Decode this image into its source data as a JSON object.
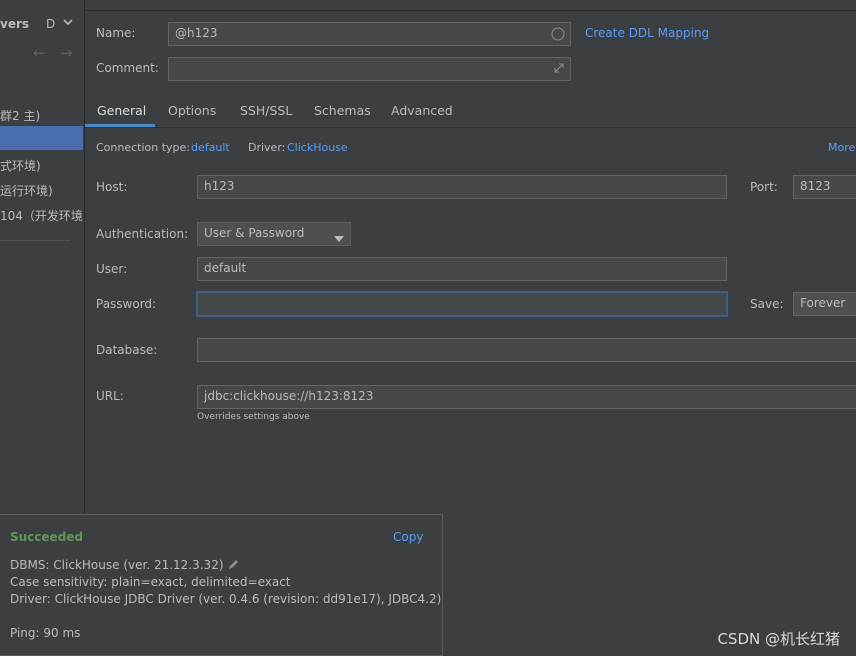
{
  "sidebar": {
    "title_fragment": "vers",
    "letter": "D",
    "items": [
      {
        "label": "群2 主)"
      },
      {
        "label": "式环境)"
      },
      {
        "label": "运行环境)"
      },
      {
        "label": "104（开发环境"
      }
    ]
  },
  "form": {
    "name_label": "Name:",
    "name_value": "@h123",
    "create_ddl_link": "Create DDL Mapping",
    "comment_label": "Comment:",
    "comment_value": ""
  },
  "tabs": [
    {
      "label": "General",
      "active": true
    },
    {
      "label": "Options"
    },
    {
      "label": "SSH/SSL"
    },
    {
      "label": "Schemas"
    },
    {
      "label": "Advanced"
    }
  ],
  "general": {
    "connection_type_label": "Connection type:",
    "connection_type_value": "default",
    "driver_label": "Driver:",
    "driver_value": "ClickHouse",
    "more_link": "More",
    "host_label": "Host:",
    "host_value": "h123",
    "port_label": "Port:",
    "port_value": "8123",
    "auth_label": "Authentication:",
    "auth_value": "User & Password",
    "user_label": "User:",
    "user_value": "default",
    "password_label": "Password:",
    "password_value": "",
    "save_label": "Save:",
    "save_value": "Forever",
    "database_label": "Database:",
    "database_value": "",
    "url_label": "URL:",
    "url_value": "jdbc:clickhouse://h123:8123",
    "url_hint": "Overrides settings above"
  },
  "popup": {
    "status": "Succeeded",
    "copy_label": "Copy",
    "dbms": "DBMS: ClickHouse (ver. 21.12.3.32)",
    "case": "Case sensitivity: plain=exact, delimited=exact",
    "driver": "Driver: ClickHouse JDBC Driver (ver. 0.4.6 (revision: dd91e17), JDBC4.2)",
    "ping": "Ping: 90 ms"
  },
  "watermark": "CSDN @机长红猪",
  "colors": {
    "background": "#3c3f41",
    "accent_link": "#589df6",
    "selection": "#4b6eaf",
    "success": "#629755",
    "field_bg": "#45494a"
  }
}
